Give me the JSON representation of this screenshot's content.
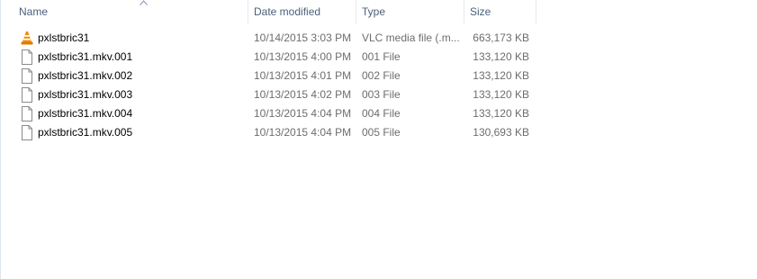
{
  "columns": {
    "name": "Name",
    "date": "Date modified",
    "type": "Type",
    "size": "Size"
  },
  "sort": {
    "column": "name",
    "direction": "ascending"
  },
  "files": [
    {
      "name": "pxlstbric31",
      "date": "10/14/2015 3:03 PM",
      "type": "VLC media file (.m...",
      "size": "663,173 KB",
      "icon": "vlc-cone-icon"
    },
    {
      "name": "pxlstbric31.mkv.001",
      "date": "10/13/2015 4:00 PM",
      "type": "001 File",
      "size": "133,120 KB",
      "icon": "generic-file-icon"
    },
    {
      "name": "pxlstbric31.mkv.002",
      "date": "10/13/2015 4:01 PM",
      "type": "002 File",
      "size": "133,120 KB",
      "icon": "generic-file-icon"
    },
    {
      "name": "pxlstbric31.mkv.003",
      "date": "10/13/2015 4:02 PM",
      "type": "003 File",
      "size": "133,120 KB",
      "icon": "generic-file-icon"
    },
    {
      "name": "pxlstbric31.mkv.004",
      "date": "10/13/2015 4:04 PM",
      "type": "004 File",
      "size": "133,120 KB",
      "icon": "generic-file-icon"
    },
    {
      "name": "pxlstbric31.mkv.005",
      "date": "10/13/2015 4:04 PM",
      "type": "005 File",
      "size": "130,693 KB",
      "icon": "generic-file-icon"
    }
  ],
  "colors": {
    "header_text": "#4c607a",
    "name_text": "#000000",
    "detail_text": "#6d6d6d",
    "vlc_orange": "#f28a00"
  }
}
